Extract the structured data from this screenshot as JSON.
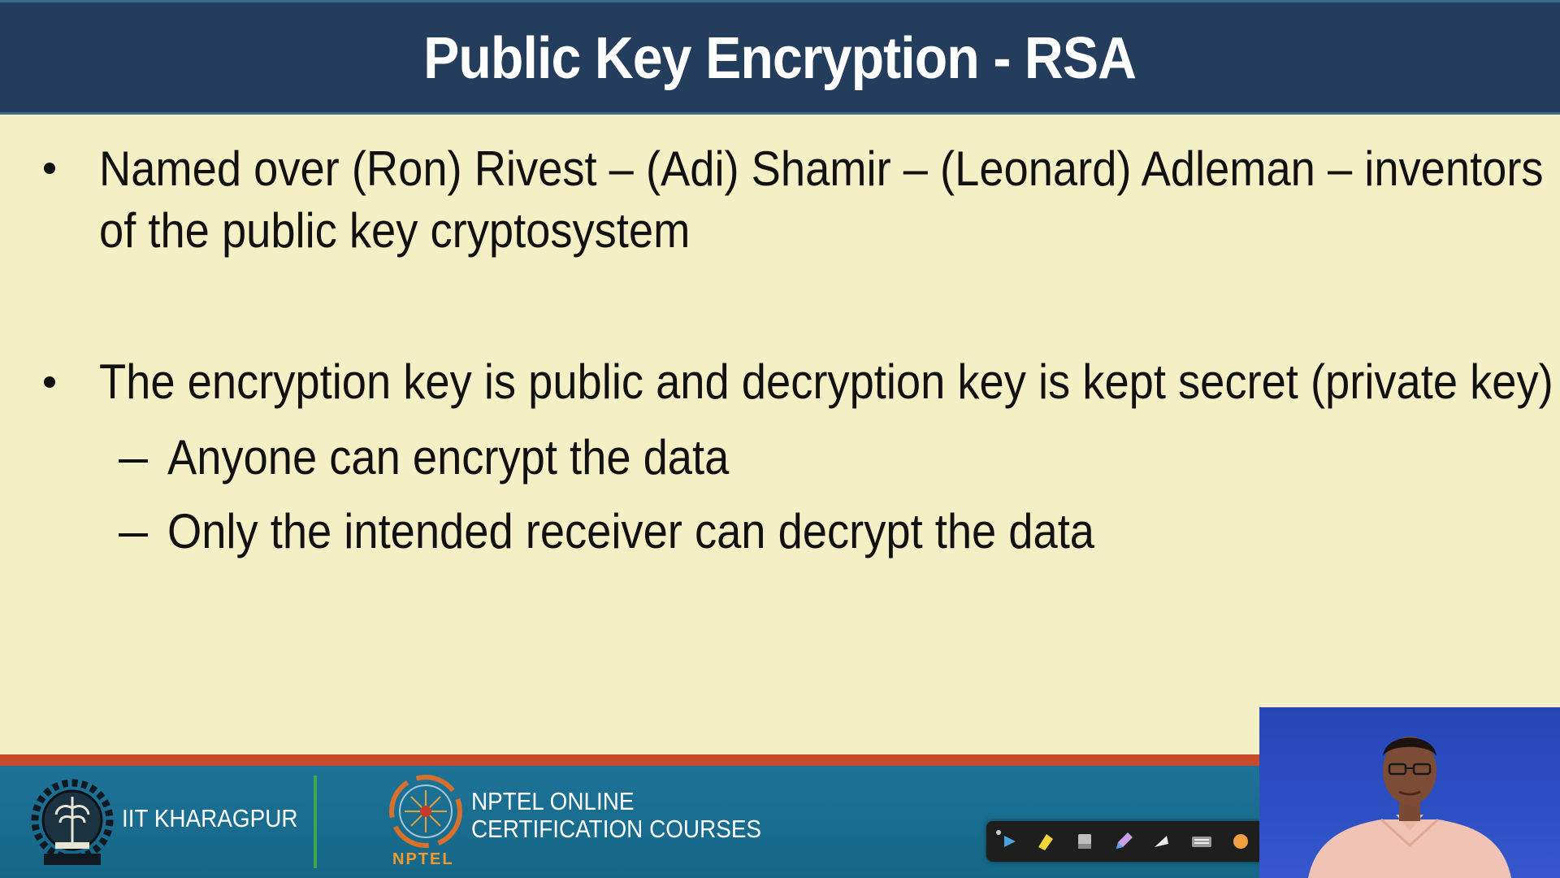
{
  "slide": {
    "title": "Public Key Encryption - RSA",
    "bullets": [
      {
        "line1": "Named over (Ron) Rivest – (Adi) Shamir – (Leonard) Adleman – inventors",
        "line2": "of the public key cryptosystem"
      },
      {
        "line1": "The encryption key is public and decryption key is kept secret (private key)",
        "subs": [
          "Anyone can encrypt the data",
          "Only the intended receiver can decrypt the data"
        ]
      }
    ]
  },
  "footer": {
    "institute": "IIT KHARAGPUR",
    "nptel_line1": "NPTEL ONLINE",
    "nptel_line2": "CERTIFICATION COURSES",
    "nptel_logo_text": "NPTEL"
  },
  "toolbar": {
    "icons": [
      "pointer-icon",
      "highlighter-icon",
      "eraser-icon",
      "pen-icon",
      "arrow-icon",
      "keyboard-icon",
      "color-icon"
    ]
  },
  "colors": {
    "title_bar": "#253d5c",
    "slide_background": "#f5efc6",
    "footer": "#1d7397",
    "accent_stripe": "#c74a2c",
    "divider": "#3ea84a"
  }
}
